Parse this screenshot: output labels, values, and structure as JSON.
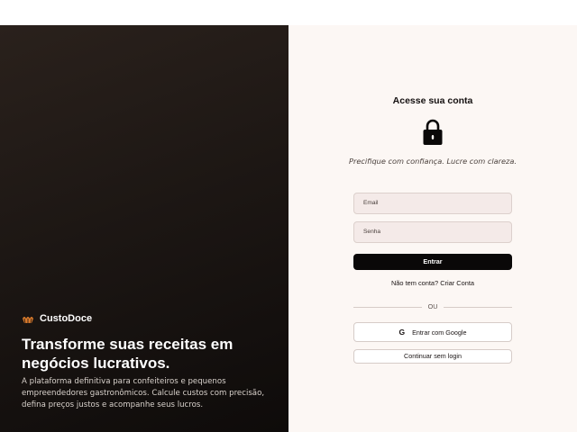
{
  "hero": {
    "brand": "CustoDoce",
    "headline": "Transforme suas receitas em negócios lucrativos.",
    "description": "A plataforma definitiva para confeiteiros e pequenos empreendedores gastronômicos. Calcule custos com precisão, defina preços justos e acompanhe seus lucros.",
    "brand_icon": "cupcake-icon",
    "accent_color": "#d97a2b"
  },
  "login": {
    "title": "Acesse sua conta",
    "lock_icon": "lock-icon",
    "tagline": "Precifique com confiança. Lucre com clareza.",
    "email_label": "Email",
    "password_label": "Senha",
    "submit_label": "Entrar",
    "signup_prompt": "Não tem conta?",
    "signup_link": "Criar Conta",
    "divider_text": "OU",
    "google_icon": "google-icon",
    "google_label": "Entrar com Google",
    "guest_label": "Continuar sem login"
  }
}
